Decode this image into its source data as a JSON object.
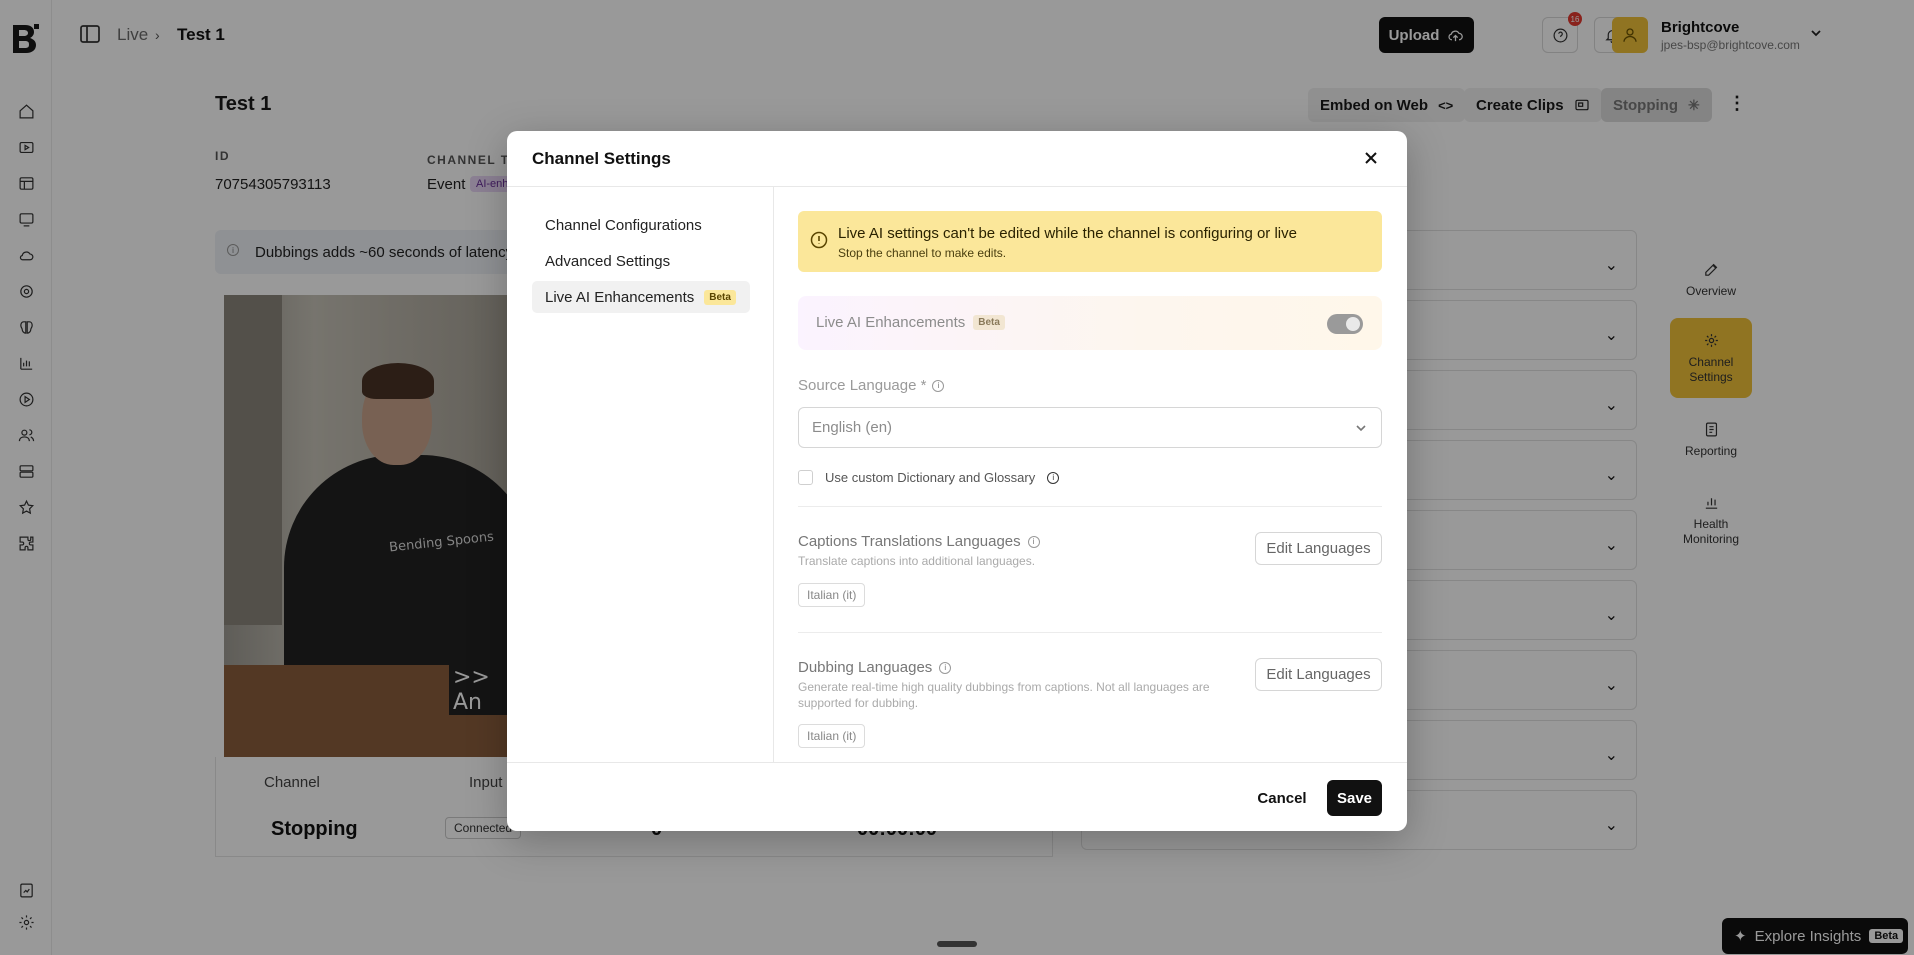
{
  "topbar": {
    "breadcrumb": {
      "parent": "Live",
      "current": "Test 1"
    },
    "upload_label": "Upload",
    "notification_count": "16",
    "account": {
      "name": "Brightcove",
      "email": "jpes-bsp@brightcove.com"
    }
  },
  "page": {
    "title": "Test 1",
    "actions": {
      "embed": "Embed on Web",
      "clips": "Create Clips",
      "status": "Stopping"
    },
    "meta": {
      "id_label": "ID",
      "id_value": "70754305793113",
      "type_label": "CHANNEL TY",
      "type_value": "Event",
      "type_chip": "AI-enh"
    },
    "latency_banner": "Dubbings adds ~60 seconds of latency",
    "video": {
      "shirt_text": "Bending Spoons",
      "caption_overlay": ">> An"
    },
    "stats": {
      "channel_label": "Channel",
      "channel_value": "Stopping",
      "input_label": "Input",
      "input_chip": "Connected",
      "value_3": "0",
      "value_4": "00:00:00"
    },
    "side_tabs": {
      "overview": "Overview",
      "channel_settings": "Channel Settings",
      "reporting": "Reporting",
      "health": "Health Monitoring"
    },
    "insights": {
      "label": "Explore Insights",
      "beta": "Beta"
    }
  },
  "modal": {
    "title": "Channel Settings",
    "nav": {
      "configurations": "Channel Configurations",
      "advanced": "Advanced Settings",
      "live_ai": "Live AI Enhancements",
      "live_ai_beta": "Beta"
    },
    "warning": {
      "title": "Live AI settings can't be edited while the channel is configuring or live",
      "subtitle": "Stop the channel to make edits."
    },
    "toggle": {
      "label": "Live AI Enhancements",
      "beta": "Beta",
      "enabled": true
    },
    "source_language": {
      "label": "Source Language *",
      "value": "English (en)"
    },
    "custom_dictionary": {
      "label": "Use custom Dictionary and Glossary",
      "checked": false
    },
    "captions": {
      "title": "Captions Translations Languages",
      "subtitle": "Translate captions into additional languages.",
      "edit_label": "Edit Languages",
      "languages": [
        "Italian (it)"
      ]
    },
    "dubbing": {
      "title": "Dubbing Languages",
      "subtitle": "Generate real-time high quality dubbings from captions. Not all languages are supported for dubbing.",
      "edit_label": "Edit Languages",
      "languages": [
        "Italian (it)"
      ]
    },
    "footer": {
      "cancel": "Cancel",
      "save": "Save"
    }
  },
  "colors": {
    "accent": "#f0c23a",
    "warning_bg": "#fbe79a",
    "primary_button": "#111111"
  }
}
